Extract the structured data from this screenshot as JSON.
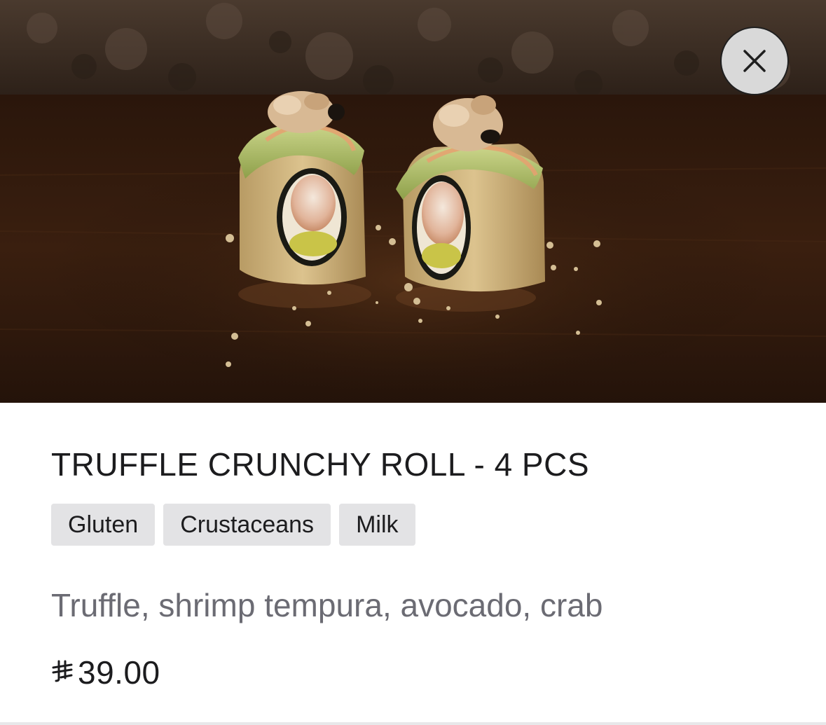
{
  "product": {
    "image_alt": "Truffle crunchy roll sushi pieces",
    "title": "TRUFFLE CRUNCHY ROLL - 4 PCS",
    "allergens": [
      "Gluten",
      "Crustaceans",
      "Milk"
    ],
    "description": "Truffle, shrimp tempura, avocado, crab",
    "currency_icon": "riyal-icon",
    "price": "39.00"
  },
  "controls": {
    "close_icon": "close-icon"
  },
  "colors": {
    "tag_background": "#e3e3e5",
    "title_text": "#1c1c1e",
    "description_text": "#6b6b73",
    "close_button_bg": "#d9d9d9"
  }
}
